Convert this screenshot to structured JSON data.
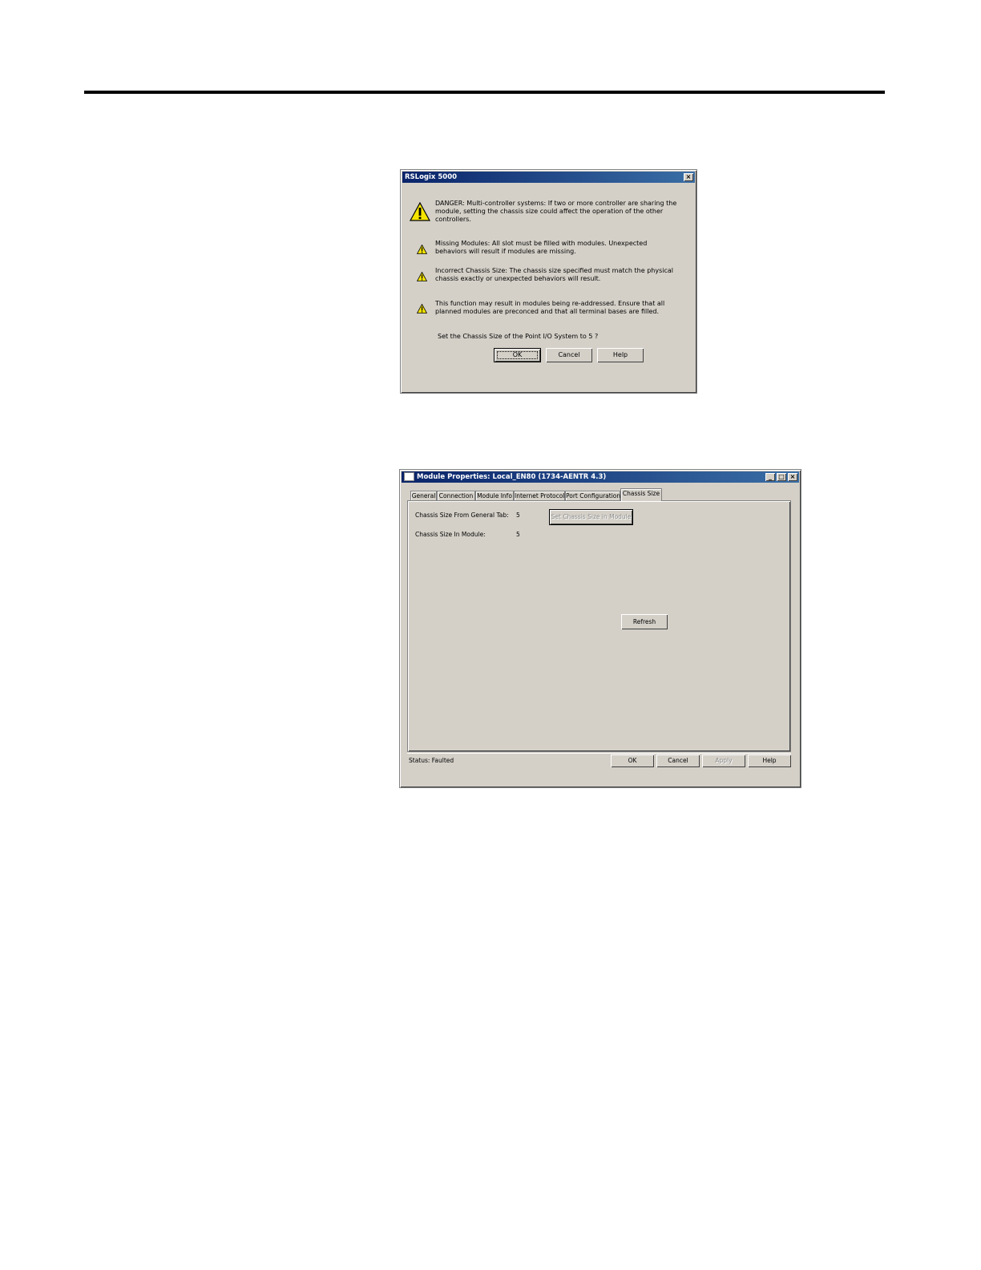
{
  "dialog1": {
    "title": "RSLogix 5000",
    "close_glyph": "×",
    "messages": [
      {
        "text": "DANGER: Multi-controller systems: If two or more controller are sharing the module, setting the chassis size could affect the operation of the other controllers.",
        "icon": "warning-icon-large"
      },
      {
        "text": "Missing Modules: All slot must be filled with modules. Unexpected behaviors will result if modules are missing.",
        "icon": "warning-icon"
      },
      {
        "text": "Incorrect Chassis Size: The chassis size specified must match the physical chassis exactly or unexpected behaviors will result.",
        "icon": "warning-icon"
      },
      {
        "text": "This function may result in modules being re-addressed. Ensure  that all planned modules are preconced and that all terminal  bases are filled.",
        "icon": "warning-icon"
      }
    ],
    "question": "Set the  Chassis Size of the Point I/O System to 5  ?",
    "buttons": {
      "ok": "OK",
      "cancel": "Cancel",
      "help": "Help"
    }
  },
  "dialog2": {
    "title": "Module Properties: Local_EN80 (1734-AENTR 4.3)",
    "window_buttons": {
      "minimize": "_",
      "maximize": "□",
      "close": "×"
    },
    "tabs": [
      "General",
      "Connection",
      "Module Info",
      "Internet Protocol",
      "Port Configuration",
      "Chassis Size"
    ],
    "active_tab": "Chassis Size",
    "fields": {
      "general_tab_label": "Chassis Size From General Tab:",
      "general_tab_value": "5",
      "module_label": "Chassis Size In Module:",
      "module_value": "5"
    },
    "set_button": "Set Chassis Size in Module",
    "refresh_button": "Refresh",
    "status": "Status:  Faulted",
    "buttons": {
      "ok": "OK",
      "cancel": "Cancel",
      "apply": "Apply",
      "help": "Help"
    }
  },
  "colors": {
    "warning_fill": "#f5e400",
    "titlebar": "#0a246a",
    "face": "#d4d0c8"
  }
}
